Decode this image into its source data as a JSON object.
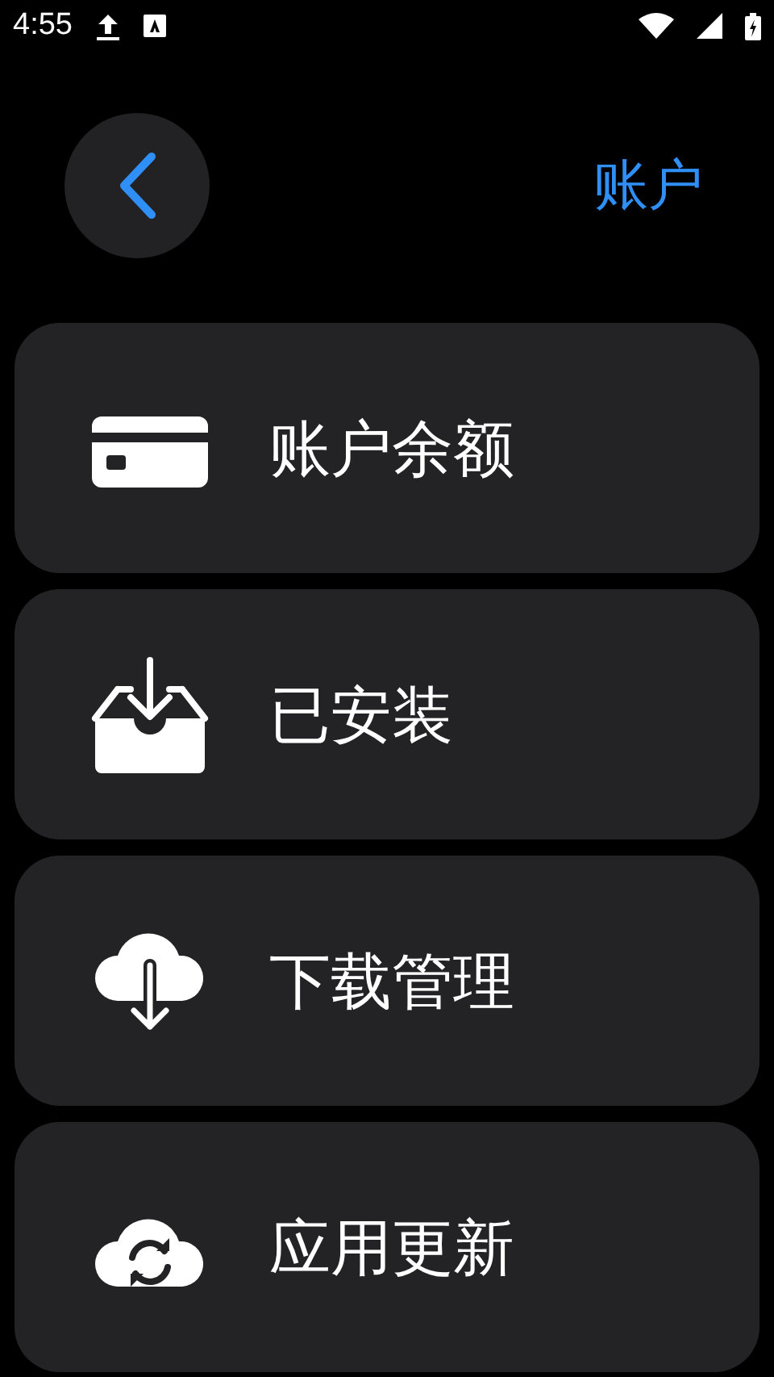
{
  "status_bar": {
    "time": "4:55"
  },
  "header": {
    "title": "账户"
  },
  "menu": [
    {
      "label": "账户余额",
      "kind": "card"
    },
    {
      "label": "已安装",
      "kind": "inbox"
    },
    {
      "label": "下载管理",
      "kind": "cloud-download"
    },
    {
      "label": "应用更新",
      "kind": "cloud-sync"
    }
  ]
}
